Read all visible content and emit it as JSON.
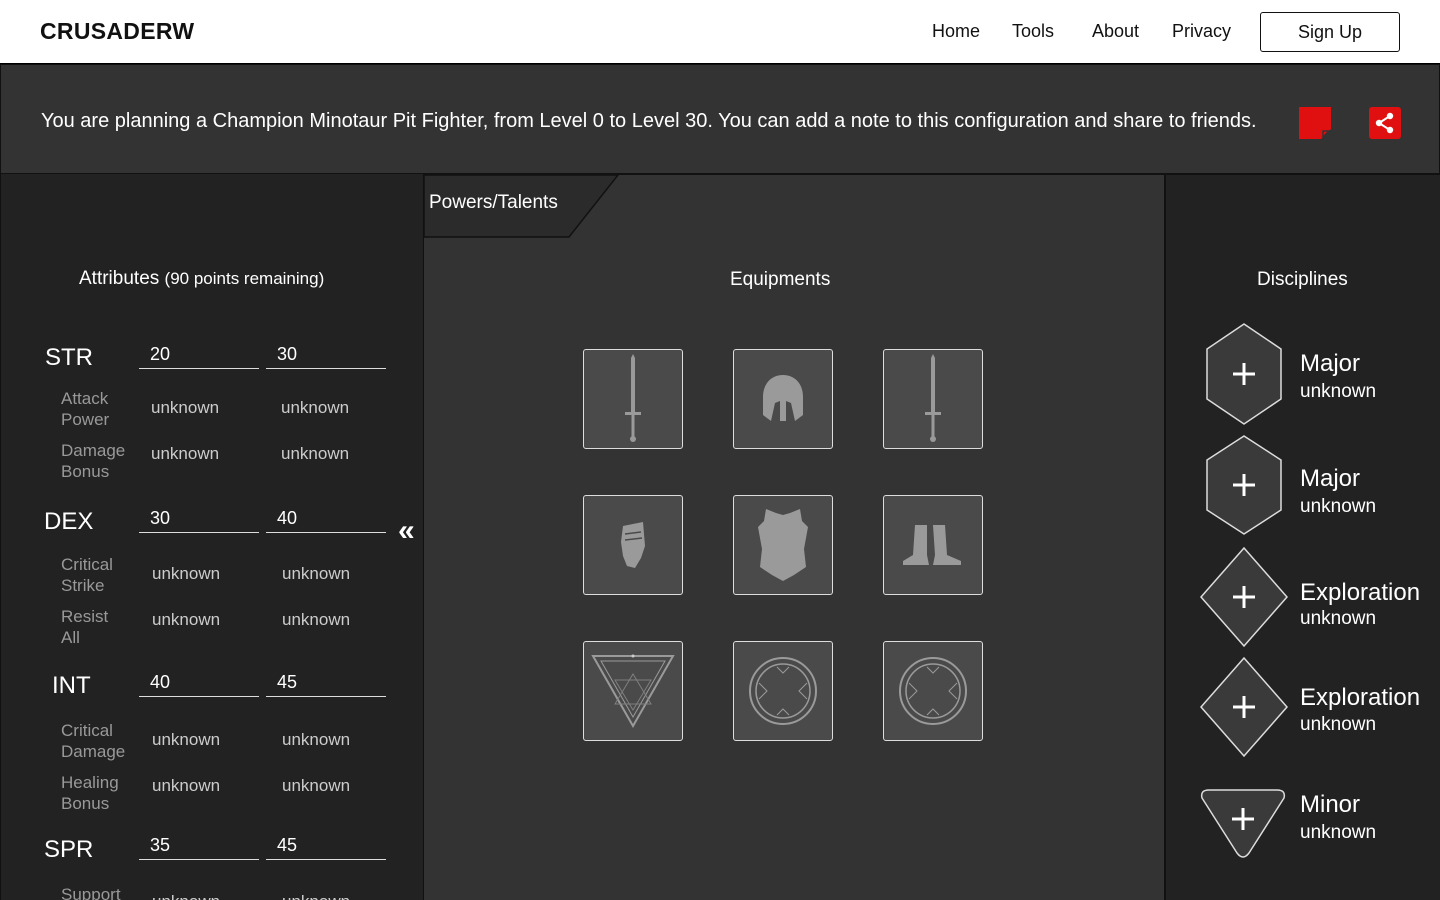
{
  "nav": {
    "brand": "CRUSADERW",
    "links": [
      "Home",
      "Tools",
      "About",
      "Privacy"
    ],
    "signup": "Sign Up"
  },
  "info": {
    "text": "You are planning a Champion Minotaur Pit Fighter, from Level 0 to Level 30. You can add a note to this configuration and share to friends.",
    "note_icon": "note-icon",
    "share_icon": "share-icon",
    "accent": "#e01010"
  },
  "attributes": {
    "title": "Attributes",
    "remaining": "(90 points remaining)",
    "groups": [
      {
        "name": "STR",
        "from": "20",
        "to": "30",
        "subs": [
          {
            "label": "Attack Power",
            "a": "unknown",
            "b": "unknown"
          },
          {
            "label": "Damage Bonus",
            "a": "unknown",
            "b": "unknown"
          }
        ]
      },
      {
        "name": "DEX",
        "from": "30",
        "to": "40",
        "subs": [
          {
            "label": "Critical Strike",
            "a": "unknown",
            "b": "unknown"
          },
          {
            "label": "Resist All",
            "a": "unknown",
            "b": "unknown"
          }
        ]
      },
      {
        "name": "INT",
        "from": "40",
        "to": "45",
        "subs": [
          {
            "label": "Critical Damage",
            "a": "unknown",
            "b": "unknown"
          },
          {
            "label": "Healing Bonus",
            "a": "unknown",
            "b": "unknown"
          }
        ]
      },
      {
        "name": "SPR",
        "from": "35",
        "to": "45",
        "subs": [
          {
            "label": "Support",
            "a": "unknown",
            "b": "unknown"
          }
        ]
      }
    ]
  },
  "center": {
    "tab": "Powers/Talents",
    "title": "Equipments",
    "slots": [
      "sword-icon",
      "helmet-icon",
      "sword-icon",
      "gauntlet-icon",
      "chestplate-icon",
      "boots-icon",
      "triangle-sigil-icon",
      "ring-icon",
      "ring-icon"
    ]
  },
  "disciplines": {
    "title": "Disciplines",
    "items": [
      {
        "name": "Major",
        "value": "unknown",
        "shape": "hexagon"
      },
      {
        "name": "Major",
        "value": "unknown",
        "shape": "hexagon"
      },
      {
        "name": "Exploration",
        "value": "unknown",
        "shape": "diamond"
      },
      {
        "name": "Exploration",
        "value": "unknown",
        "shape": "diamond"
      },
      {
        "name": "Minor",
        "value": "unknown",
        "shape": "shield"
      }
    ]
  }
}
